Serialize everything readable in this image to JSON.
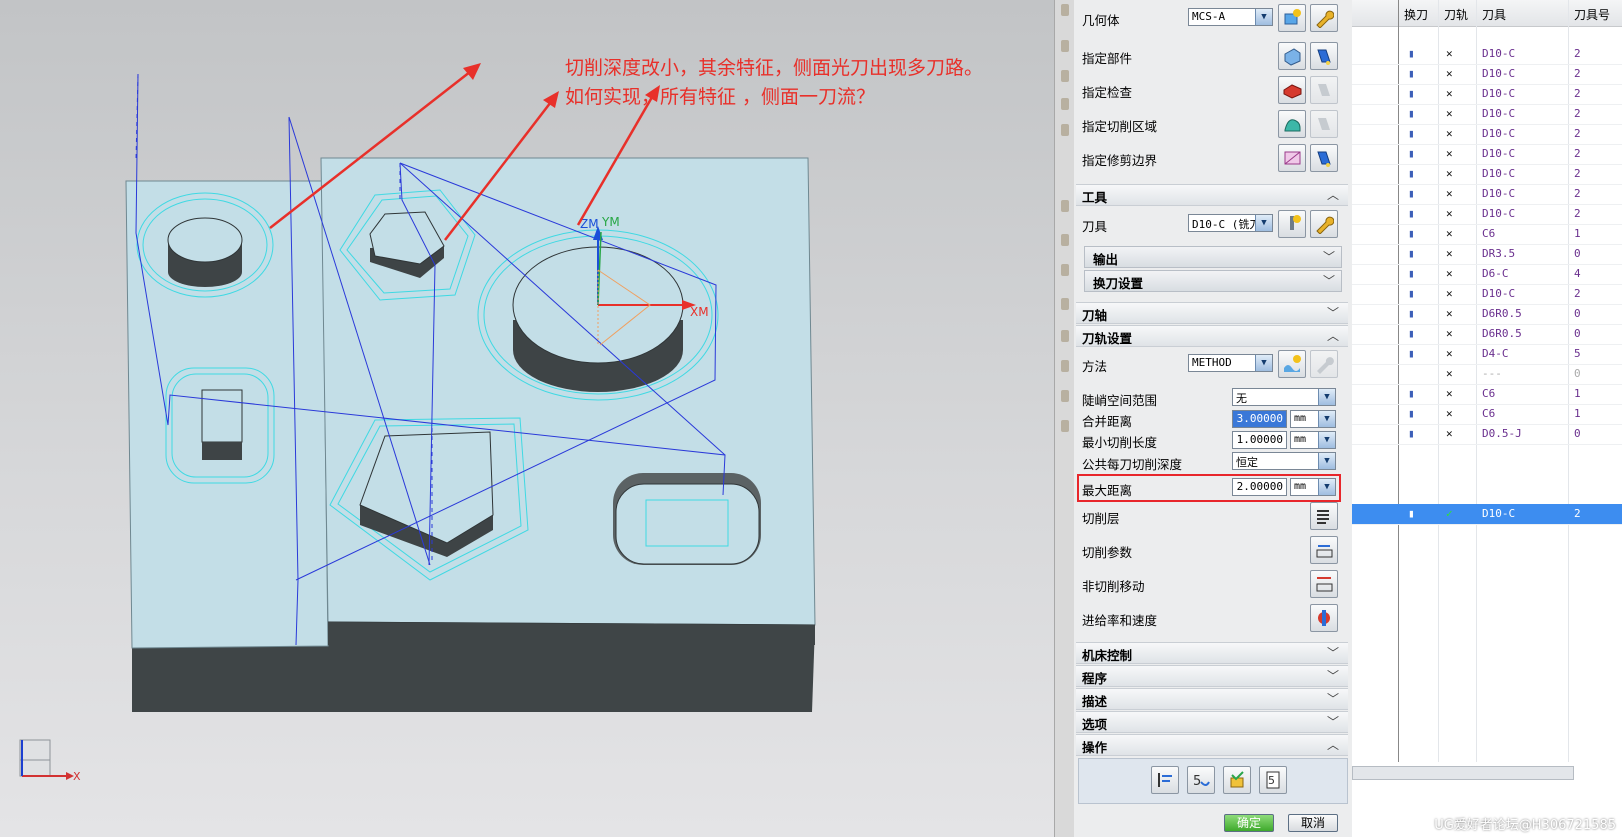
{
  "annotation": {
    "line1": "切削深度改小，其余特征，侧面光刀出现多刀路。",
    "line2": "如何实现，所有特征 ，侧面一刀流？"
  },
  "viewport": {
    "axis_labels": {
      "zm": "ZM",
      "ym": "YM",
      "xm": "XM"
    },
    "triad_x_label": "X"
  },
  "dialog": {
    "geometry": {
      "label": "几何体",
      "value": "MCS-A",
      "rows": [
        "指定部件",
        "指定检查",
        "指定切削区域",
        "指定修剪边界"
      ]
    },
    "tool_section": {
      "title": "工具",
      "tool_label": "刀具",
      "tool_value": "D10-C (铣刀",
      "sub_output": "输出",
      "sub_change": "换刀设置"
    },
    "axis_section": {
      "title": "刀轴"
    },
    "path_section": {
      "title": "刀轨设置",
      "method_label": "方法",
      "method_value": "METHOD",
      "steep_label": "陡峭空间范围",
      "steep_value": "无",
      "merge_label": "合并距离",
      "merge_value": "3.00000",
      "merge_unit": "mm",
      "mincut_label": "最小切削长度",
      "mincut_value": "1.00000",
      "mincut_unit": "mm",
      "depth_label": "公共每刀切削深度",
      "depth_value": "恒定",
      "maxdist_label": "最大距离",
      "maxdist_value": "2.00000",
      "maxdist_unit": "mm",
      "actions": [
        "切削层",
        "切削参数",
        "非切削移动",
        "进给率和速度"
      ]
    },
    "collapsed_sections": [
      "机床控制",
      "程序",
      "描述",
      "选项"
    ],
    "ops_section": {
      "title": "操作"
    },
    "ok_label": "确定",
    "cancel_label": "取消"
  },
  "navigator": {
    "columns": [
      "换刀",
      "刀轨",
      "刀具",
      "刀具号"
    ],
    "rows": [
      {
        "tool": "D10-C",
        "num": "2"
      },
      {
        "tool": "D10-C",
        "num": "2"
      },
      {
        "tool": "D10-C",
        "num": "2"
      },
      {
        "tool": "D10-C",
        "num": "2"
      },
      {
        "tool": "D10-C",
        "num": "2"
      },
      {
        "tool": "D10-C",
        "num": "2"
      },
      {
        "tool": "D10-C",
        "num": "2"
      },
      {
        "tool": "D10-C",
        "num": "2"
      },
      {
        "tool": "D10-C",
        "num": "2"
      },
      {
        "tool": "C6",
        "num": "1"
      },
      {
        "tool": "DR3.5",
        "num": "0"
      },
      {
        "tool": "D6-C",
        "num": "4"
      },
      {
        "tool": "D10-C",
        "num": "2"
      },
      {
        "tool": "D6R0.5",
        "num": "0"
      },
      {
        "tool": "D6R0.5",
        "num": "0"
      },
      {
        "tool": "D4-C",
        "num": "5"
      },
      {
        "tool": "---",
        "num": "0"
      },
      {
        "tool": "C6",
        "num": "1"
      },
      {
        "tool": "C6",
        "num": "1"
      },
      {
        "tool": "D0.5-J",
        "num": "0"
      }
    ],
    "selected_row": {
      "tool": "D10-C",
      "num": "2"
    }
  },
  "watermark": "UG爱好者论坛@H306721585",
  "colors": {
    "annotation": "#e8302a",
    "highlight": "#e8262b",
    "selection": "#3d8df0",
    "part": "#c3dee7",
    "toolpath": "#2a39d9"
  }
}
